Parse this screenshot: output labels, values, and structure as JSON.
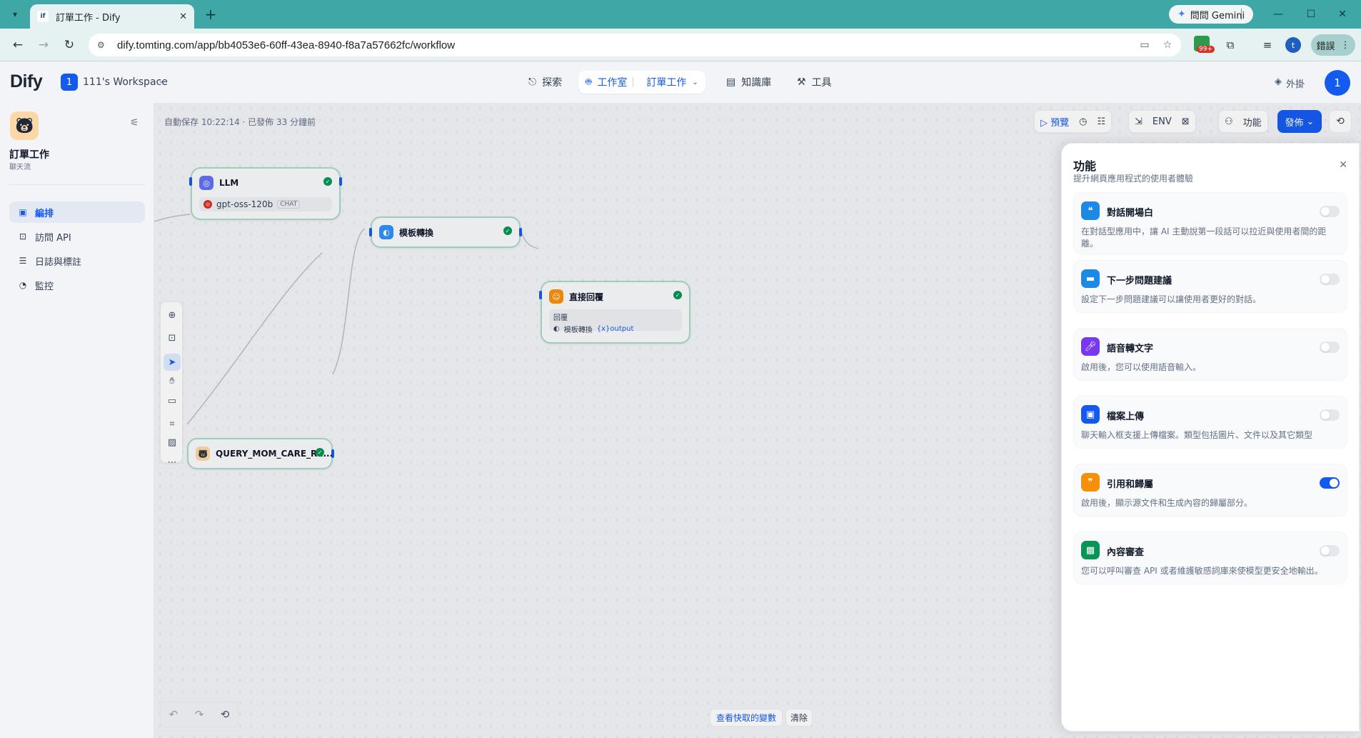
{
  "browser": {
    "tab_title": "訂單工作 - Dify",
    "favicon_text": "if",
    "gemini_label": "問問 Gemini",
    "url": "dify.tomting.com/app/bb4053e6-60ff-43ea-8940-f8a7a57662fc/workflow",
    "ext_badge": "99+",
    "profile_initial": "t",
    "reload_label": "錯誤"
  },
  "header": {
    "logo": "Dify",
    "workspace_initial": "1",
    "workspace_name": "111's Workspace",
    "nav_explore": "探索",
    "nav_studio": "工作室",
    "nav_current_app": "訂單工作",
    "nav_knowledge": "知識庫",
    "nav_tools": "工具",
    "plugins": "外掛",
    "avatar_initial": "1"
  },
  "sidebar": {
    "app_name": "訂單工作",
    "app_mode": "聊天流",
    "items": [
      {
        "label": "編排",
        "icon": "layout-icon"
      },
      {
        "label": "訪問 API",
        "icon": "terminal-icon"
      },
      {
        "label": "日誌與標註",
        "icon": "file-list-icon"
      },
      {
        "label": "監控",
        "icon": "dashboard-icon"
      }
    ]
  },
  "canvas": {
    "autosave": "自動保存 10:22:14 · 已發佈 33 分鐘前",
    "toolbar": {
      "preview": "預覽",
      "features": "功能",
      "publish": "發佈"
    },
    "nodes": {
      "llm": {
        "title": "LLM",
        "model": "gpt-oss-120b",
        "model_tag": "CHAT"
      },
      "template": {
        "title": "模板轉換"
      },
      "answer": {
        "title": "直接回覆",
        "label": "回覆",
        "var_node": "模板轉換",
        "var_name": "{x}output"
      },
      "knowledge": {
        "title": "QUERY_MOM_CARE_RE..."
      }
    },
    "variable_inspect": "查看快取的變數",
    "clear": "清除"
  },
  "features_panel": {
    "title": "功能",
    "subtitle": "提升網頁應用程式的使用者體驗",
    "features": [
      {
        "name": "對話開場白",
        "desc": "在對話型應用中，讓 AI 主動說第一段話可以拉近與使用者間的距離。",
        "icon_color": "#1e88e5",
        "enabled": false
      },
      {
        "name": "下一步問題建議",
        "desc": "設定下一步問題建議可以讓使用者更好的對話。",
        "icon_color": "#1e88e5",
        "enabled": false
      },
      {
        "name": "語音轉文字",
        "desc": "啟用後，您可以使用語音輸入。",
        "icon_color": "#7839ee",
        "enabled": false
      },
      {
        "name": "檔案上傳",
        "desc": "聊天輸入框支援上傳檔案。類型包括圖片、文件以及其它類型",
        "icon_color": "#155aef",
        "enabled": false
      },
      {
        "name": "引用和歸屬",
        "desc": "啟用後，顯示源文件和生成內容的歸屬部分。",
        "icon_color": "#f79009",
        "enabled": true
      },
      {
        "name": "內容審查",
        "desc": "您可以呼叫審查 API 或者維護敏感詞庫來使模型更安全地輸出。",
        "icon_color": "#079455",
        "enabled": false
      }
    ]
  }
}
